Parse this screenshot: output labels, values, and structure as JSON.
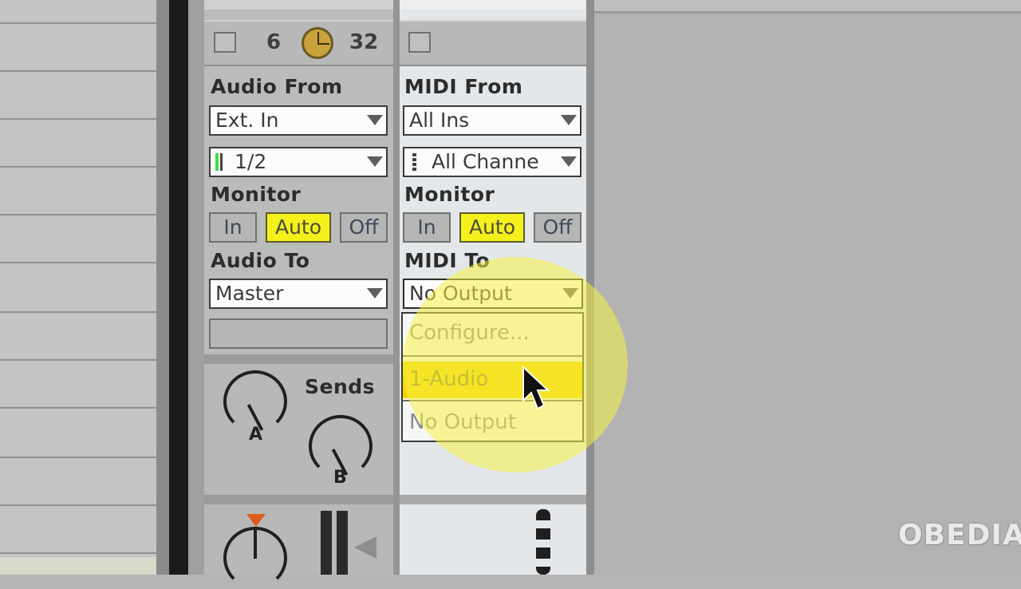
{
  "audio_track": {
    "header": {
      "value_a": "6",
      "value_b": "32"
    },
    "input_label": "Audio From",
    "input_type": "Ext. In",
    "input_channel": "1/2",
    "monitor_label": "Monitor",
    "monitor_in": "In",
    "monitor_auto": "Auto",
    "monitor_off": "Off",
    "output_label": "Audio To",
    "output_value": "Master",
    "sends_label": "Sends",
    "send_a": "A",
    "send_b": "B"
  },
  "midi_track": {
    "input_label": "MIDI From",
    "input_type": "All Ins",
    "input_channel": "All Channe",
    "monitor_label": "Monitor",
    "monitor_in": "In",
    "monitor_auto": "Auto",
    "monitor_off": "Off",
    "output_label": "MIDI To",
    "output_value": "No Output"
  },
  "midi_to_menu": {
    "items": [
      "Configure...",
      "1-Audio",
      "No Output"
    ],
    "selected": "1-Audio"
  },
  "watermark": "OBEDIA",
  "colors": {
    "active_button": "#f4f01c",
    "menu_highlight": "#f5d400",
    "cursor_highlight": "#f6f246"
  }
}
